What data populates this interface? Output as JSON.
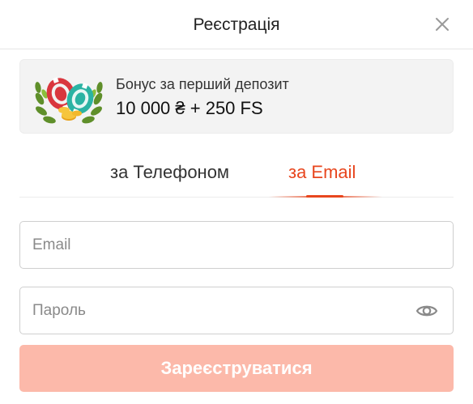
{
  "header": {
    "title": "Реєстрація",
    "close_icon": "close-icon"
  },
  "bonus": {
    "label": "Бонус за перший депозит",
    "value": "10 000 ₴ + 250 FS",
    "art_icon": "casino-chips-laurel-icon"
  },
  "tabs": {
    "items": [
      {
        "label": "за Телефоном",
        "active": false
      },
      {
        "label": "за Email",
        "active": true
      }
    ],
    "active_color": "#e8461e"
  },
  "form": {
    "email_placeholder": "Email",
    "email_value": "",
    "password_placeholder": "Пароль",
    "password_value": "",
    "password_toggle_icon": "eye-icon",
    "submit_label": "Зареєструватися",
    "submit_color": "#fcb9aa"
  }
}
